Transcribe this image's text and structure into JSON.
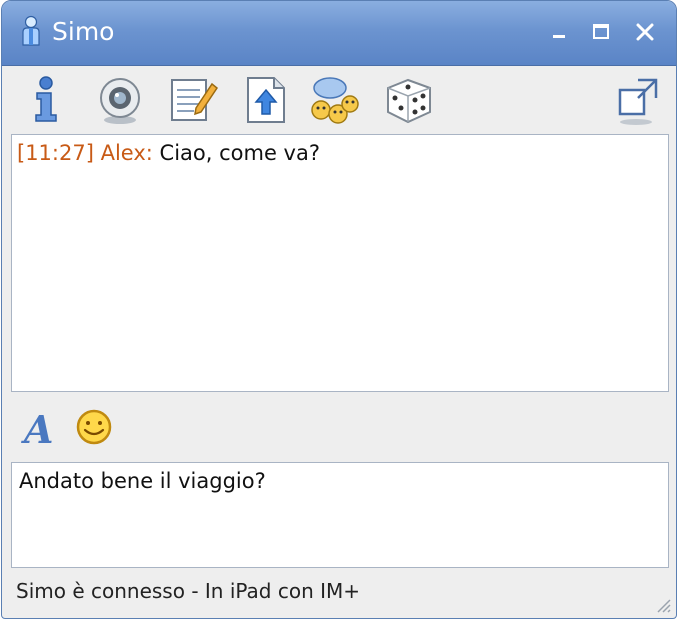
{
  "window": {
    "title": "Simo",
    "icons": {
      "title": "user-icon",
      "minimize": "minimize-icon",
      "maximize": "maximize-icon",
      "close": "close-icon"
    }
  },
  "toolbar": {
    "items": [
      {
        "name": "info",
        "icon": "info-icon"
      },
      {
        "name": "webcam",
        "icon": "webcam-icon"
      },
      {
        "name": "notes",
        "icon": "notepad-icon"
      },
      {
        "name": "file-transfer",
        "icon": "upload-file-icon"
      },
      {
        "name": "group-chat",
        "icon": "group-chat-icon"
      },
      {
        "name": "game",
        "icon": "dice-icon"
      },
      {
        "name": "detach",
        "icon": "popout-window-icon"
      }
    ]
  },
  "history": {
    "messages": [
      {
        "time": "[11:27]",
        "sender": "Alex:",
        "text": "Ciao, come va?"
      }
    ]
  },
  "format": {
    "font_icon": "font-style-icon",
    "emoticon_icon": "smiley-icon"
  },
  "input": {
    "value": "Andato bene il viaggio?"
  },
  "status": {
    "text": "Simo è connesso - In iPad con IM+"
  },
  "colors": {
    "titlebar": "#6c94d0",
    "sender": "#c85a16",
    "border": "#a9b4c4"
  }
}
